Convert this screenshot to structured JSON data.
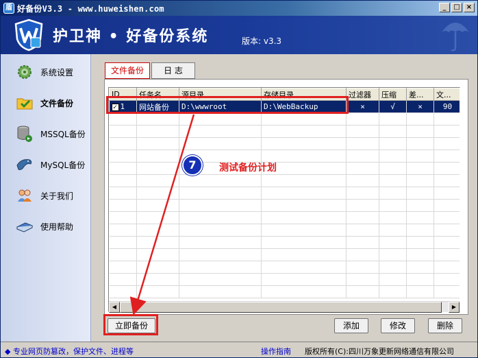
{
  "window": {
    "title": "好备份V3.3 - www.huweishen.com",
    "minimize": "_",
    "maximize": "□",
    "close": "×"
  },
  "banner": {
    "brand": "护卫神 • 好备份系统",
    "version": "版本: v3.3"
  },
  "sidebar": {
    "items": [
      {
        "label": "系统设置",
        "icon": "gear-icon"
      },
      {
        "label": "文件备份",
        "icon": "folder-icon"
      },
      {
        "label": "MSSQL备份",
        "icon": "database-icon"
      },
      {
        "label": "MySQL备份",
        "icon": "dolphin-icon"
      },
      {
        "label": "关于我们",
        "icon": "people-icon"
      },
      {
        "label": "使用帮助",
        "icon": "book-icon"
      }
    ]
  },
  "tabs": [
    {
      "label": "文件备份",
      "active": true
    },
    {
      "label": "日 志",
      "active": false
    }
  ],
  "table": {
    "columns": [
      "ID",
      "任务名",
      "源目录",
      "存储目录",
      "过滤器",
      "压缩",
      "差...",
      "文..."
    ],
    "rows": [
      {
        "checked": true,
        "id": "1",
        "name": "网站备份",
        "source": "D:\\wwwroot",
        "target": "D:\\WebBackup",
        "filter": "×",
        "compress": "√",
        "diff": "×",
        "file": "90"
      }
    ]
  },
  "buttons": {
    "backup_now": "立即备份",
    "add": "添加",
    "edit": "修改",
    "delete": "删除"
  },
  "annotation": {
    "number": "7",
    "text": "测试备份计划",
    "color": "#e02020"
  },
  "statusbar": {
    "left": "◆ 专业网页防篡改，保护文件、进程等",
    "guide": "操作指南",
    "copyright": "版权所有(C):四川万象更新网络通信有限公司"
  }
}
